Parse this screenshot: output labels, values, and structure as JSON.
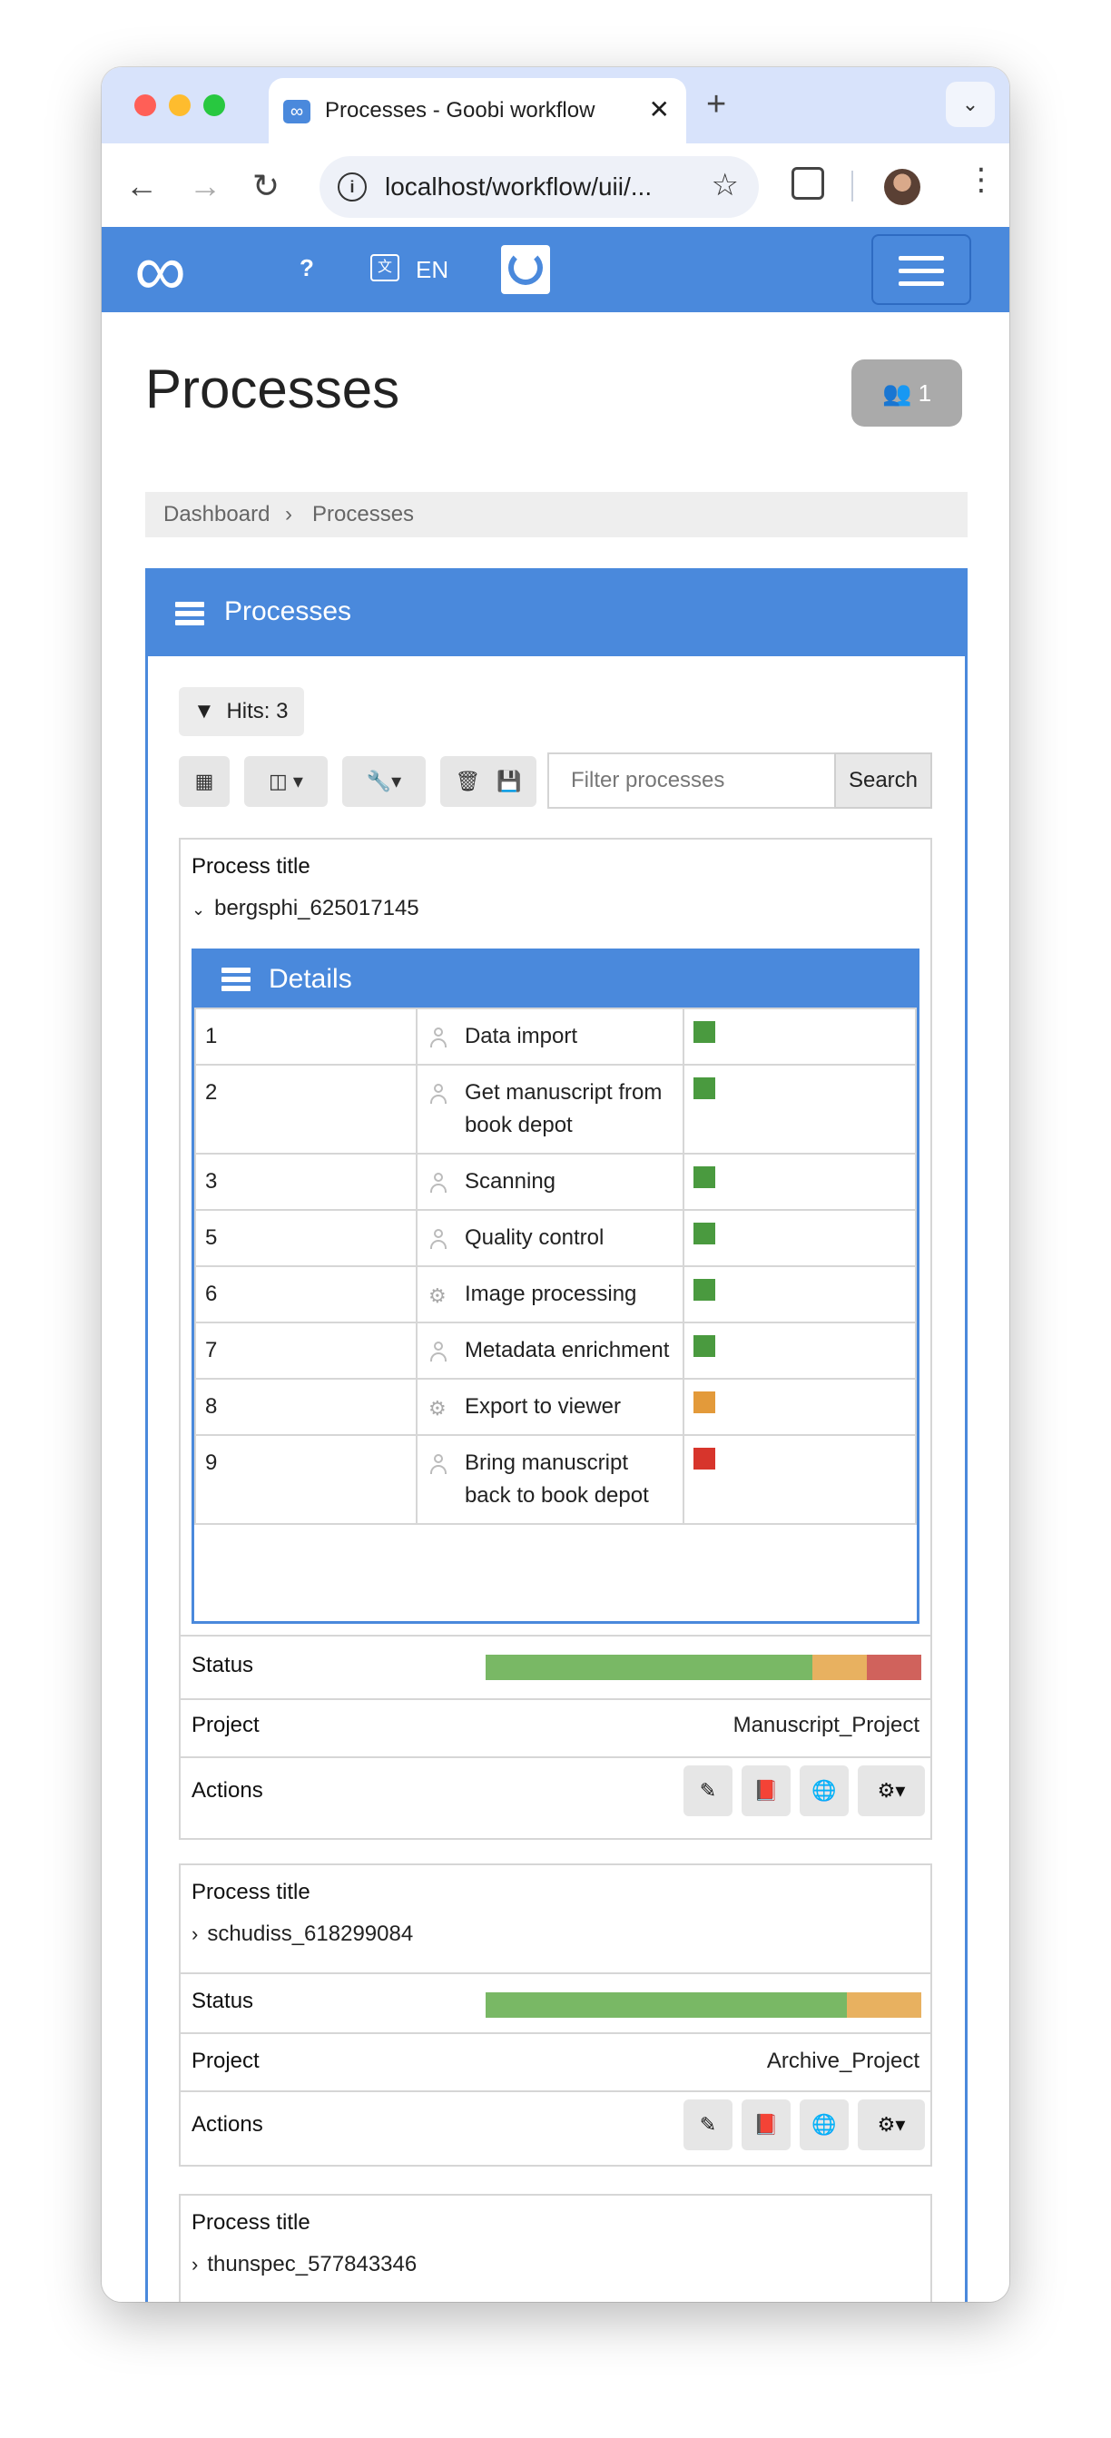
{
  "browser": {
    "tab_title": "Processes - Goobi workflow",
    "favicon": "∞",
    "tab_close": "✕",
    "new_tab": "+",
    "url": "localhost/workflow/uii/...",
    "icons": [
      "back-arrow-icon",
      "forward-arrow-icon",
      "reload-icon",
      "site-info-icon",
      "bookmark-star-icon",
      "extensions-icon",
      "profile-avatar",
      "browser-menu-icon"
    ]
  },
  "appnav": {
    "logo": "∞",
    "help": "?",
    "lang_icon": "文",
    "lang": "EN"
  },
  "page": {
    "title": "Processes",
    "users_count": "1"
  },
  "breadcrumb": {
    "items": [
      "Dashboard",
      "Processes"
    ],
    "separator": "›"
  },
  "box": {
    "title": "Processes",
    "hits": "Hits: 3",
    "filter_placeholder": "Filter processes",
    "search_label": "Search"
  },
  "labels": {
    "process_title": "Process title",
    "details": "Details",
    "status": "Status",
    "project": "Project",
    "actions": "Actions"
  },
  "processes": [
    {
      "title": "bergsphi_625017145",
      "expanded": true,
      "project": "Manuscript_Project",
      "status_fractions": {
        "done": 0.75,
        "open": 0.125,
        "error": 0.125
      },
      "steps": [
        {
          "num": "1",
          "task": "Data import",
          "type": "user",
          "status": "done"
        },
        {
          "num": "2",
          "task": "Get manuscript from book depot",
          "type": "user",
          "status": "done"
        },
        {
          "num": "3",
          "task": "Scanning",
          "type": "user",
          "status": "done"
        },
        {
          "num": "5",
          "task": "Quality control",
          "type": "user",
          "status": "done"
        },
        {
          "num": "6",
          "task": "Image processing",
          "type": "automatic",
          "status": "done"
        },
        {
          "num": "7",
          "task": "Metadata enrichment",
          "type": "user",
          "status": "done"
        },
        {
          "num": "8",
          "task": "Export to viewer",
          "type": "automatic",
          "status": "open"
        },
        {
          "num": "9",
          "task": "Bring manuscript back to book depot",
          "type": "user",
          "status": "error"
        }
      ]
    },
    {
      "title": "schudiss_618299084",
      "expanded": false,
      "project": "Archive_Project",
      "status_fractions": {
        "done": 0.83,
        "open": 0.17,
        "error": 0
      }
    },
    {
      "title": "thunspec_577843346",
      "expanded": false
    }
  ],
  "colors": {
    "brand": "#4a89dc",
    "step_done": "#4a9a3f",
    "step_open": "#e39a3a",
    "step_error": "#d7352c",
    "bar_done": "#79b865",
    "bar_open": "#e8b160",
    "bar_error": "#d0625c"
  }
}
